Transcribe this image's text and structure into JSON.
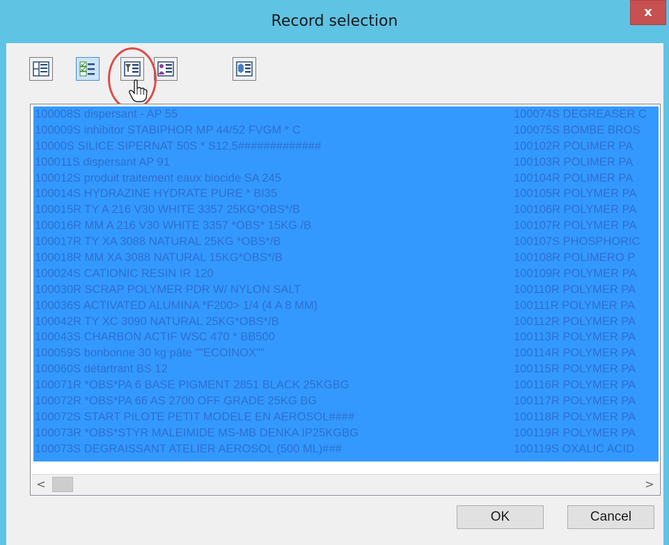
{
  "window": {
    "title": "Record selection",
    "close_label": "x"
  },
  "toolbar": {
    "buttons": [
      {
        "name": "layout-view-icon",
        "active": false
      },
      {
        "name": "checklist-view-icon",
        "active": true
      },
      {
        "name": "filter-list-icon",
        "active": false
      },
      {
        "name": "user-list-icon",
        "active": false
      },
      {
        "name": "database-list-icon",
        "active": false
      }
    ]
  },
  "list": {
    "column1": [
      "100008S dispersant - AP 55",
      "100009S inhibitor STABIPHOR MP 44/52 FVGM * C",
      "10000S SILICE SIPERNAT 50S * S12,5#############",
      "100011S dispersant AP 91",
      "100012S produit traitement eaux biocide SA 245",
      "100014S HYDRAZINE HYDRATE PURE * BI35",
      "100015R TY A 216 V30 WHITE 3357 25KG*OBS*/B",
      "100016R MM A 216 V30 WHITE 3357 *OBS* 15KG /B",
      "100017R TY XA 3088  NATURAL  25KG *OBS*/B",
      "100018R MM XA 3088 NATURAL 15KG*OBS*/B",
      "100024S CATIONIC RESIN IR 120",
      "100030R SCRAP POLYMER PDR W/ NYLON SALT",
      "100036S ACTIVATED ALUMINA *F200> 1/4 (4 A 8 MM)",
      "100042R TY XC 3090 NATURAL 25KG*OBS*/B",
      "100043S CHARBON ACTIF WSC 470 * BB500",
      "100059S bonbonne 30 kg pâte \"\"ECOINOX\"\"",
      "100060S détartrant BS 12",
      "100071R *OBS*PA 6 BASE PIGMENT 2851 BLACK 25KGBG",
      "100072R *OBS*PA 66 AS 2700 OFF GRADE 25KG BG",
      "100072S START PILOTE PETIT MODELE EN AEROSOL####",
      "100073R *OBS*STYR MALEIMIDE MS-MB DENKA IP25KGBG",
      "100073S DEGRAISSANT ATELIER  AEROSOL (500 ML)###"
    ],
    "column2": [
      "100074S DEGREASER C",
      "100075S BOMBE BROS",
      "100102R POLIMER PA",
      "100103R POLIMER PA",
      "100104R POLIMER PA",
      "100105R POLYMER PA",
      "100106R POLYMER PA",
      "100107R POLYMER PA",
      "100107S PHOSPHORIC",
      "100108R POLIMERO P",
      "100109R POLYMER PA",
      "100110R POLYMER PA",
      "100111R POLYMER PA",
      "100112R POLYMER PA",
      "100113R POLYMER PA",
      "100114R POLYMER PA",
      "100115R POLYMER PA",
      "100116R POLYMER PA",
      "100117R POLYMER PA",
      "100118R POLYMER PA",
      "100119R POLYMER PA",
      "100119S OXALIC ACID"
    ]
  },
  "scrollbar": {
    "left_arrow": "<",
    "right_arrow": ">"
  },
  "buttons": {
    "ok": "OK",
    "cancel": "Cancel"
  },
  "colors": {
    "selection": "#3399ff",
    "title_bar": "#5fc3e4",
    "close": "#c75050",
    "selected_text": "#2f6fcf"
  }
}
